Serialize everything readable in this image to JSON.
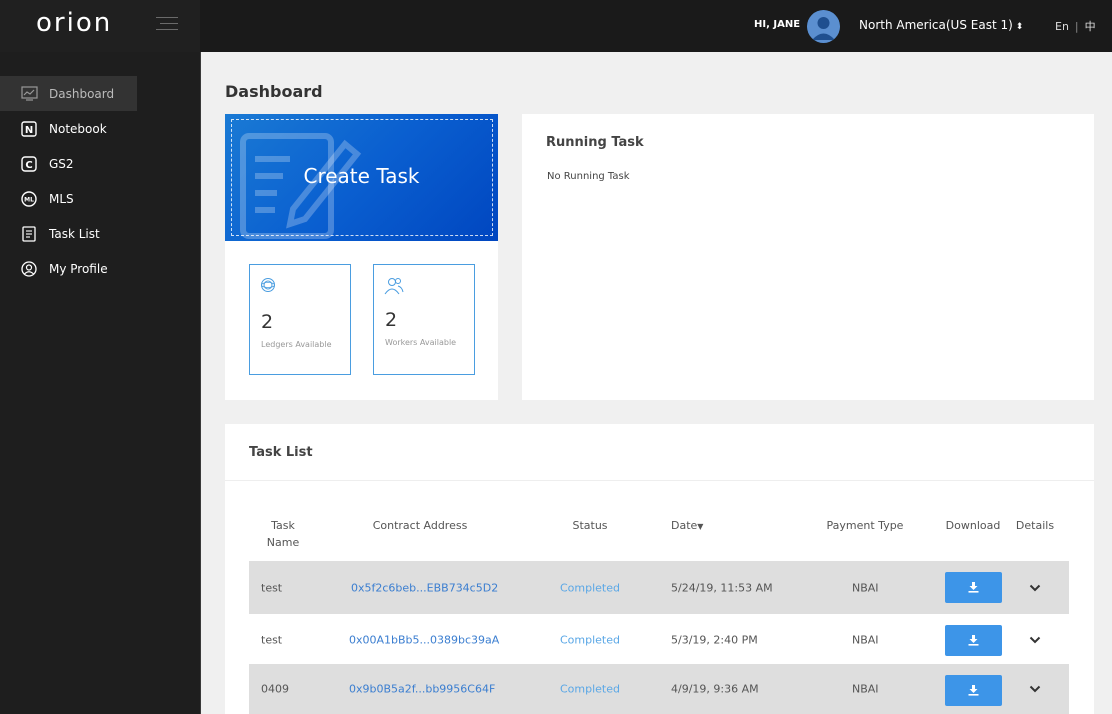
{
  "header": {
    "logo_text": "orion",
    "greeting": "HI, JANE",
    "region": "North America(US East 1)",
    "lang_en": "En",
    "lang_sep": "|",
    "lang_zh": "中"
  },
  "sidebar": {
    "items": [
      {
        "label": "Dashboard",
        "icon": "chart-icon",
        "active": true
      },
      {
        "label": "Notebook",
        "icon": "notebook-icon"
      },
      {
        "label": "GS2",
        "icon": "gs2-icon"
      },
      {
        "label": "MLS",
        "icon": "mls-icon"
      },
      {
        "label": "Task List",
        "icon": "task-list-icon"
      },
      {
        "label": "My Profile",
        "icon": "profile-icon"
      }
    ]
  },
  "main": {
    "page_title": "Dashboard",
    "create_task_label": "Create Task",
    "stats": [
      {
        "value": "2",
        "label": "Ledgers Available",
        "icon": "ledger-icon"
      },
      {
        "value": "2",
        "label": "Workers Available",
        "icon": "workers-icon"
      }
    ],
    "running": {
      "title": "Running Task",
      "empty_text": "No Running Task"
    },
    "task_list": {
      "title": "Task List",
      "columns": {
        "task_name_line1": "Task",
        "task_name_line2": "Name",
        "contract": "Contract Address",
        "status": "Status",
        "date": "Date",
        "payment": "Payment Type",
        "download": "Download",
        "details": "Details"
      },
      "rows": [
        {
          "name": "test",
          "contract": "0x5f2c6beb...EBB734c5D2",
          "status": "Completed",
          "date": "5/24/19, 11:53 AM",
          "payment": "NBAI"
        },
        {
          "name": "test",
          "contract": "0x00A1bBb5...0389bc39aA",
          "status": "Completed",
          "date": "5/3/19, 2:40 PM",
          "payment": "NBAI"
        },
        {
          "name": "0409",
          "contract": "0x9b0B5a2f...bb9956C64F",
          "status": "Completed",
          "date": "4/9/19, 9:36 AM",
          "payment": "NBAI"
        }
      ]
    }
  },
  "colors": {
    "accent": "#3d95e8",
    "link": "#3b7ed0",
    "status": "#5aa7e6",
    "topbar": "#1a1a1a"
  }
}
